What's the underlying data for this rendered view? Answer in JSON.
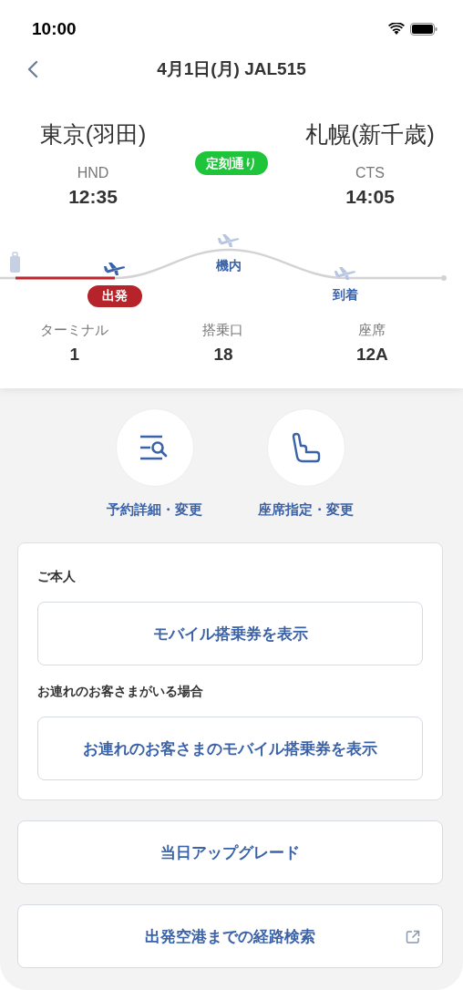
{
  "status_bar": {
    "time": "10:00"
  },
  "header": {
    "title": "4月1日(月) JAL515"
  },
  "route": {
    "origin": {
      "city": "東京(羽田)",
      "code": "HND",
      "time": "12:35"
    },
    "destination": {
      "city": "札幌(新千歳)",
      "code": "CTS",
      "time": "14:05"
    },
    "status": "定刻通り"
  },
  "stages": [
    {
      "label": "出発",
      "active": true
    },
    {
      "label": "機内",
      "active": false
    },
    {
      "label": "到着",
      "active": false
    }
  ],
  "details": [
    {
      "label": "ターミナル",
      "value": "1"
    },
    {
      "label": "搭乗口",
      "value": "18"
    },
    {
      "label": "座席",
      "value": "12A"
    }
  ],
  "actions": [
    {
      "kind": "reservation",
      "label": "予約詳細・変更"
    },
    {
      "kind": "seat",
      "label": "座席指定・変更"
    }
  ],
  "boarding_card": {
    "sections": [
      {
        "heading": "ご本人",
        "button": "モバイル搭乗券を表示"
      },
      {
        "heading": "お連れのお客さまがいる場合",
        "button": "お連れのお客さまのモバイル搭乗券を表示"
      }
    ]
  },
  "buttons": [
    {
      "label": "当日アップグレード",
      "external": false
    },
    {
      "label": "出発空港までの経路検索",
      "external": true
    }
  ]
}
